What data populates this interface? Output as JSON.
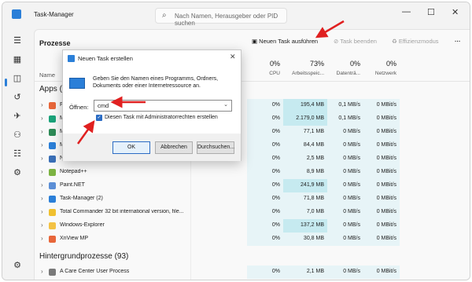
{
  "window": {
    "title": "Task-Manager"
  },
  "search": {
    "placeholder": "Nach Namen, Herausgeber oder PID suchen"
  },
  "toolbar": {
    "page_title": "Prozesse",
    "new_task": "Neuen Task ausführen",
    "end_task": "Task beenden",
    "efficiency": "Effizienzmodus",
    "more": "···"
  },
  "columns": {
    "name": "Name",
    "cpu": {
      "pct": "0%",
      "label": "CPU"
    },
    "memory": {
      "pct": "73%",
      "label": "Arbeitsspeic..."
    },
    "disk": {
      "pct": "0%",
      "label": "Datenträ..."
    },
    "network": {
      "pct": "0%",
      "label": "Netzwerk"
    }
  },
  "sections": {
    "apps": "Apps (1",
    "background": "Hintergrundprozesse (93)"
  },
  "rows": [
    {
      "name": "Fi",
      "cpu": "0%",
      "mem": "195,4 MB",
      "disk": "0,1 MB/s",
      "net": "0 MBit/s",
      "color": "#e8663a"
    },
    {
      "name": "M",
      "cpu": "0%",
      "mem": "2.179,0 MB",
      "disk": "0,1 MB/s",
      "net": "0 MBit/s",
      "color": "#1aa37a"
    },
    {
      "name": "M",
      "cpu": "0%",
      "mem": "77,1 MB",
      "disk": "0 MB/s",
      "net": "0 MBit/s",
      "color": "#2e8b57"
    },
    {
      "name": "M",
      "cpu": "0%",
      "mem": "84,4 MB",
      "disk": "0 MB/s",
      "net": "0 MBit/s",
      "color": "#2b7fd8"
    },
    {
      "name": "N",
      "cpu": "0%",
      "mem": "2,5 MB",
      "disk": "0 MB/s",
      "net": "0 MBit/s",
      "color": "#3a6fb7"
    },
    {
      "name": "Notepad++",
      "cpu": "0%",
      "mem": "8,9 MB",
      "disk": "0 MB/s",
      "net": "0 MBit/s",
      "color": "#7cb342"
    },
    {
      "name": "Paint.NET",
      "cpu": "0%",
      "mem": "241,9 MB",
      "disk": "0 MB/s",
      "net": "0 MBit/s",
      "color": "#5c8fd6"
    },
    {
      "name": "Task-Manager (2)",
      "cpu": "0%",
      "mem": "71,8 MB",
      "disk": "0 MB/s",
      "net": "0 MBit/s",
      "color": "#2b7fd8"
    },
    {
      "name": "Total Commander 32 bit international version, file...",
      "cpu": "0%",
      "mem": "7,0 MB",
      "disk": "0 MB/s",
      "net": "0 MBit/s",
      "color": "#f0c030"
    },
    {
      "name": "Windows-Explorer",
      "cpu": "0%",
      "mem": "137,2 MB",
      "disk": "0 MB/s",
      "net": "0 MBit/s",
      "color": "#f3c244"
    },
    {
      "name": "XnView MP",
      "cpu": "0%",
      "mem": "30,8 MB",
      "disk": "0 MB/s",
      "net": "0 MBit/s",
      "color": "#e8663a"
    }
  ],
  "bg_rows": [
    {
      "name": "A Care Center User Process",
      "cpu": "0%",
      "mem": "2,1 MB",
      "disk": "0 MB/s",
      "net": "0 MBit/s",
      "color": "#7a7a7a"
    }
  ],
  "dialog": {
    "title": "Neuen Task erstellen",
    "description": "Geben Sie den Namen eines Programms, Ordners, Dokuments oder einer Internetressource an.",
    "open_label": "Öffnen:",
    "input_value": "cmd",
    "checkbox_label": "Diesen Task mit Administratorrechten erstellen",
    "ok": "OK",
    "cancel": "Abbrechen",
    "browse": "Durchsuchen..."
  },
  "colors": {
    "accent": "#2b7fd8",
    "highlight": "#e7f4f7",
    "annotation": "#e02020"
  }
}
